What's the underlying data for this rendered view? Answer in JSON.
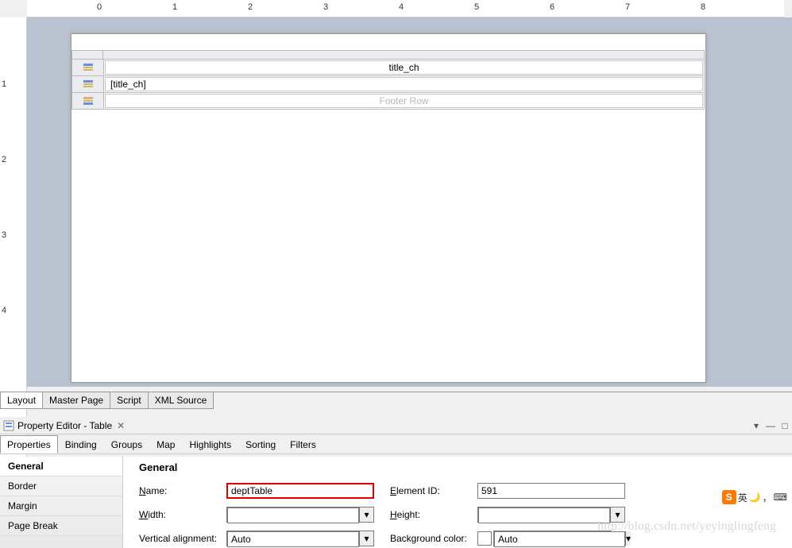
{
  "ruler_h": [
    "0",
    "1",
    "2",
    "3",
    "4",
    "5",
    "6",
    "7",
    "8"
  ],
  "ruler_v": [
    "1",
    "2",
    "3",
    "4"
  ],
  "design": {
    "header_cell": "title_ch",
    "detail_cell": "[title_ch]",
    "footer_cell": "Footer Row"
  },
  "editor_tabs": [
    "Layout",
    "Master Page",
    "Script",
    "XML Source"
  ],
  "property_panel_title": "Property Editor - Table",
  "property_tabs": [
    "Properties",
    "Binding",
    "Groups",
    "Map",
    "Highlights",
    "Sorting",
    "Filters"
  ],
  "sidebar_categories": [
    "General",
    "Border",
    "Margin",
    "Page Break"
  ],
  "general": {
    "heading": "General",
    "name_label": "Name:",
    "name_value": "deptTable",
    "elementid_label": "Element ID:",
    "elementid_value": "591",
    "width_label": "Width:",
    "width_value": "",
    "height_label": "Height:",
    "height_value": "",
    "valign_label": "Vertical alignment:",
    "valign_value": "Auto",
    "bgcolor_label": "Background color:",
    "bgcolor_value": "Auto"
  },
  "watermark": "http://blog.csdn.net/yeyinglingfeng",
  "ime_label": "英"
}
